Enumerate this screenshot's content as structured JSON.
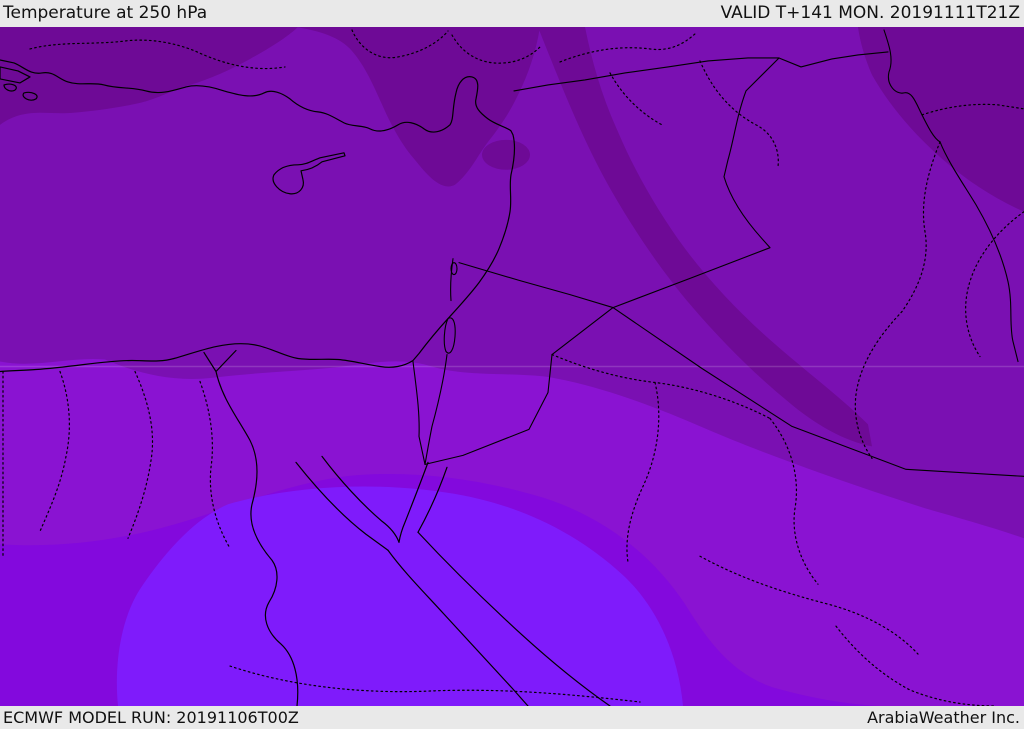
{
  "header": {
    "title": "Temperature at 250 hPa",
    "valid_time": "VALID T+141 MON. 20191111T21Z"
  },
  "footer": {
    "model_run": "ECMWF MODEL RUN: 20191106T00Z",
    "credit": "ArabiaWeather Inc."
  },
  "map": {
    "parameter": "Temperature at 250 hPa",
    "palette": {
      "bar_bg": "#e9e9e9",
      "bar_text": "#111111",
      "line": "#000000",
      "graticule": "rgba(255,255,255,0.16)",
      "band_darkest": "#6e0a96",
      "band_dark": "#7a10b2",
      "band_medium": "#8a13d2",
      "band_bright": "#8309dd",
      "band_brightest": "#7f1bfb"
    },
    "bands": [
      {
        "name": "darkest-purple-north-and-northeast",
        "color": "#6e0a96"
      },
      {
        "name": "dark-purple-base-mediterranean-levant",
        "color": "#7a10b2"
      },
      {
        "name": "medium-purple-north-egypt-north-saudi",
        "color": "#8a13d2"
      },
      {
        "name": "bright-violet-southwest",
        "color": "#8309dd"
      },
      {
        "name": "brightest-blue-violet-south-egypt-red-sea",
        "color": "#7f1bfb"
      }
    ]
  }
}
